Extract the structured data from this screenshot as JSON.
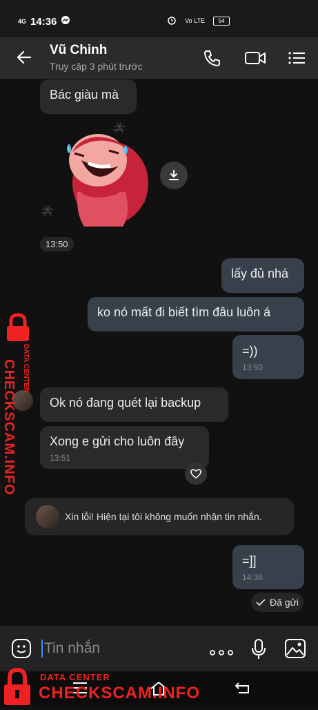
{
  "status_bar": {
    "network": "4G",
    "time": "14:36",
    "right_label": "Vo LTE",
    "battery": "54"
  },
  "header": {
    "contact_name": "Vũ Chinh",
    "contact_status": "Truy cập 3 phút trước"
  },
  "messages": [
    {
      "text": "Bác giàu mà"
    },
    {
      "time": "13:50"
    },
    {
      "text": "lấy đủ nhá"
    },
    {
      "text": "ko nó mất đi biết tìm đâu luôn á"
    },
    {
      "text": "=))",
      "time": "13:50"
    },
    {
      "text": "Ok nó đang quét lại backup"
    },
    {
      "text": "Xong e gửi cho luôn đây",
      "time": "13:51"
    },
    {
      "text": "=]]",
      "time": "14:36"
    }
  ],
  "notice": {
    "text": "Xin lỗi! Hiện tại tôi không muốn nhận tin nhắn."
  },
  "sent_status": "Đã gửi",
  "input": {
    "placeholder": "Tin nhắn"
  },
  "watermark": {
    "small": "DATA CENTER",
    "big": "CHECKSCAM.INFO",
    "side_small": "DATA CENTER",
    "side_big": "CHECKSCAM.INFO"
  },
  "colors": {
    "bubble_other": "#2a2a2a",
    "bubble_me": "#38404b",
    "watermark": "#e22222",
    "cursor": "#3a8cff"
  }
}
